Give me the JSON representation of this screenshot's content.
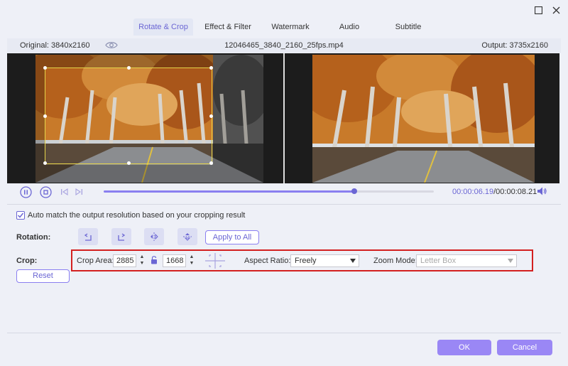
{
  "window": {
    "maximize_icon": "maximize-icon",
    "close_icon": "close-icon"
  },
  "tabs": [
    {
      "label": "Rotate & Crop",
      "active": true
    },
    {
      "label": "Effect & Filter",
      "active": false
    },
    {
      "label": "Watermark",
      "active": false
    },
    {
      "label": "Audio",
      "active": false
    },
    {
      "label": "Subtitle",
      "active": false
    }
  ],
  "infobar": {
    "original": "Original: 3840x2160",
    "filename": "12046465_3840_2160_25fps.mp4",
    "output": "Output: 3735x2160"
  },
  "player": {
    "current_time": "00:00:06.19",
    "total_time": "/00:00:08.21",
    "progress": 0.76
  },
  "options": {
    "auto_match_label": "Auto match the output resolution based on your cropping result",
    "auto_match_checked": true
  },
  "rotation": {
    "label": "Rotation:",
    "apply_all": "Apply to All"
  },
  "crop": {
    "label": "Crop:",
    "area_label": "Crop Area:",
    "width": "2885",
    "height": "1668",
    "aspect_label": "Aspect Ratio:",
    "aspect_value": "Freely",
    "zoom_label": "Zoom Mode:",
    "zoom_value": "Letter Box",
    "reset": "Reset"
  },
  "footer": {
    "ok": "OK",
    "cancel": "Cancel"
  },
  "colors": {
    "accent": "#6b66d4",
    "button": "#9a87f5",
    "highlight": "#d32020"
  }
}
